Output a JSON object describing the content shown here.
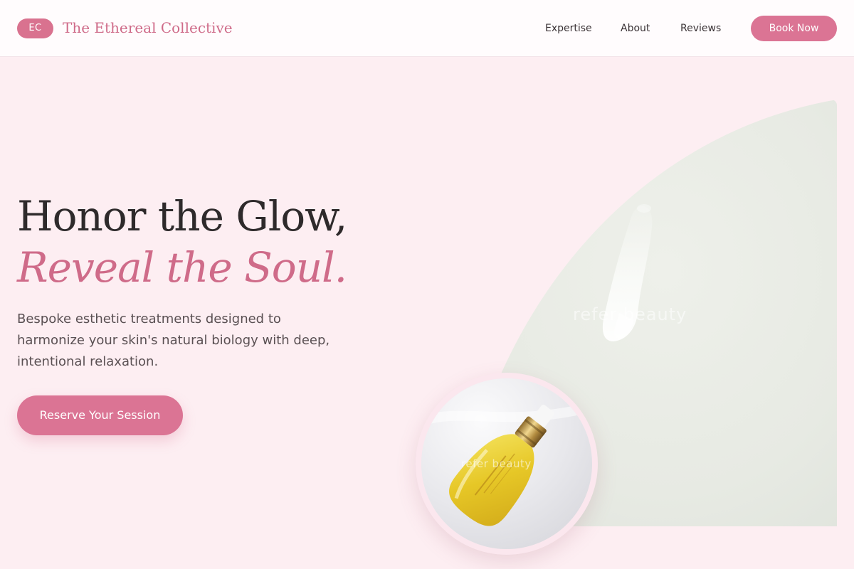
{
  "header": {
    "logo_initials": "EC",
    "brand_name": "The Ethereal Collective",
    "nav": [
      "Expertise",
      "About",
      "Reviews"
    ],
    "cta_label": "Book Now"
  },
  "hero": {
    "title_line1": "Honor the Glow,",
    "title_line2": "Reveal the Soul.",
    "description": "Bespoke esthetic treatments designed to harmonize your skin's natural biology with deep, intentional relaxation.",
    "cta_label": "Reserve Your Session",
    "photo_watermark": "refer beauty",
    "product_watermark": "refer beauty"
  },
  "colors": {
    "accent": "#db7494",
    "brand_text": "#cf6b89",
    "page_bg": "#fdeef2",
    "header_bg": "#fffcfd",
    "heading": "#2e2a2b",
    "body_text": "#5a5053"
  }
}
